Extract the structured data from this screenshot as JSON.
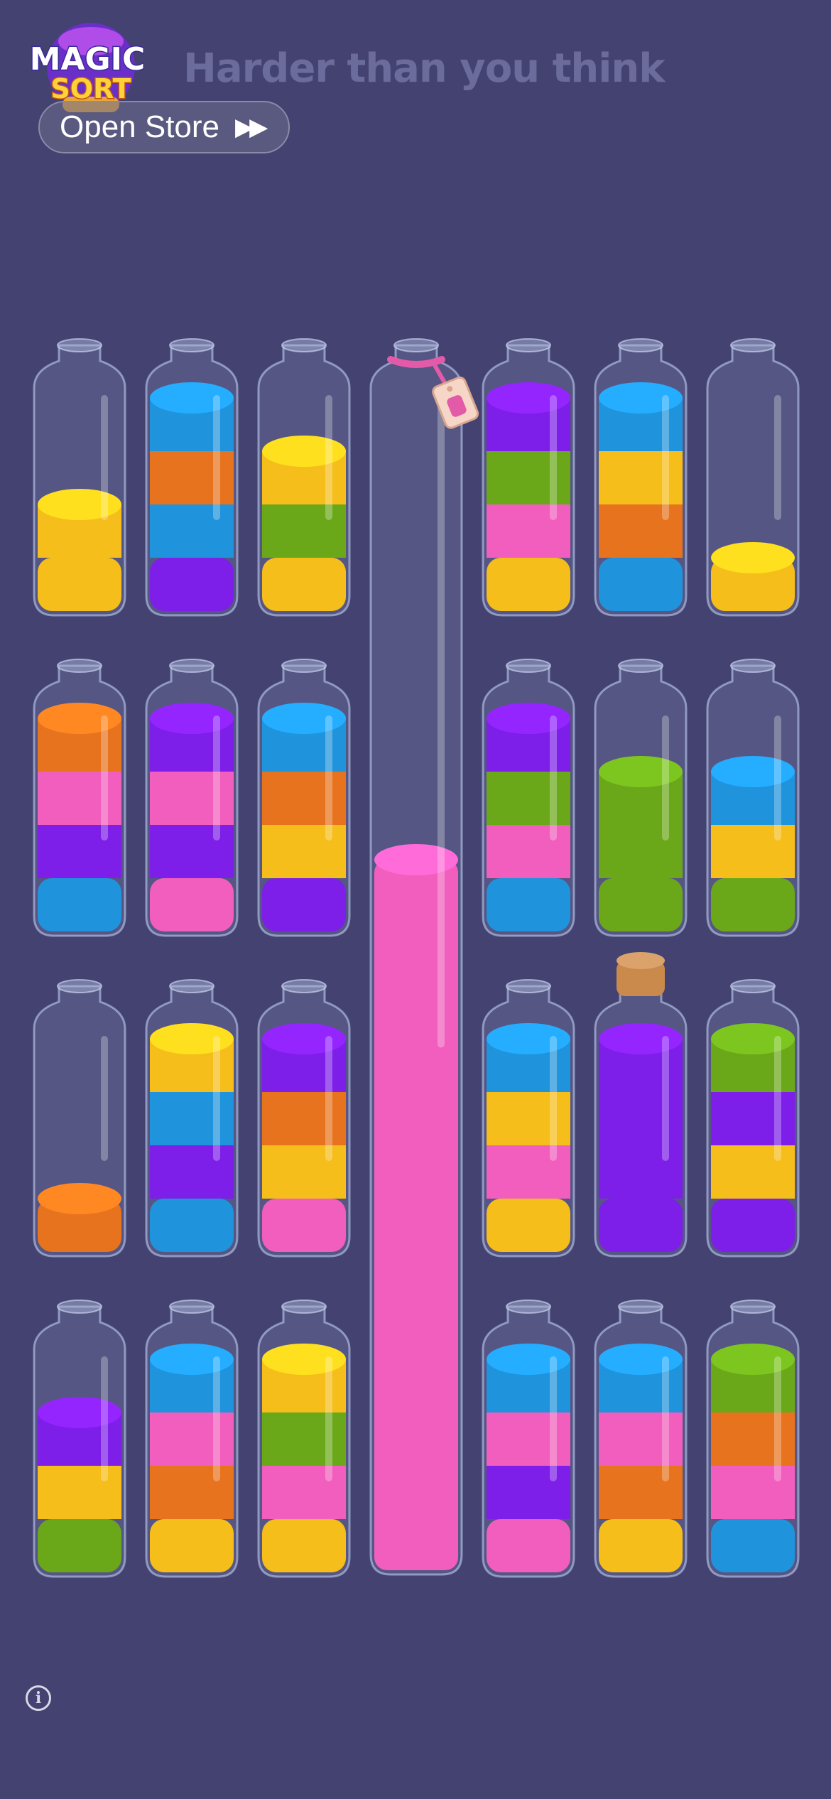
{
  "app": {
    "logo_line1": "MAGIC",
    "logo_line2": "SORT",
    "tagline": "Harder than you think",
    "store_button_label": "Open Store",
    "store_button_icon": "fast-forward-icon",
    "info_icon": "info-icon"
  },
  "colors": {
    "background": "#434270",
    "yellow": "#f5be1a",
    "blue": "#1f93dc",
    "orange": "#e8731e",
    "purple": "#7d1fe8",
    "green": "#6aa81a",
    "pink": "#f25ebd"
  },
  "board": {
    "rows": [
      {
        "bottles": [
          {
            "layers": [
              "yellow",
              "yellow"
            ]
          },
          {
            "layers": [
              "purple",
              "blue",
              "orange",
              "blue"
            ]
          },
          {
            "layers": [
              "yellow",
              "green",
              "yellow"
            ]
          },
          {
            "tall": true,
            "locked_tag": "gift-tag-icon",
            "fill_fraction": 0.59,
            "layers": [
              "pink"
            ]
          },
          {
            "layers": [
              "yellow",
              "pink",
              "green",
              "purple"
            ]
          },
          {
            "layers": [
              "blue",
              "orange",
              "yellow",
              "blue"
            ]
          },
          {
            "layers": [
              "yellow"
            ]
          }
        ]
      },
      {
        "bottles": [
          {
            "layers": [
              "blue",
              "purple",
              "pink",
              "orange"
            ]
          },
          {
            "layers": [
              "pink",
              "purple",
              "pink",
              "purple"
            ]
          },
          {
            "layers": [
              "purple",
              "yellow",
              "orange",
              "blue"
            ]
          },
          {
            "skip": true
          },
          {
            "layers": [
              "blue",
              "pink",
              "green",
              "purple"
            ]
          },
          {
            "layers": [
              "green",
              "green",
              "green"
            ]
          },
          {
            "layers": [
              "green",
              "yellow",
              "blue"
            ]
          }
        ]
      },
      {
        "bottles": [
          {
            "layers": [
              "orange"
            ]
          },
          {
            "layers": [
              "blue",
              "purple",
              "blue",
              "yellow"
            ]
          },
          {
            "layers": [
              "pink",
              "yellow",
              "orange",
              "purple"
            ]
          },
          {
            "skip": true
          },
          {
            "layers": [
              "yellow",
              "pink",
              "yellow",
              "blue"
            ]
          },
          {
            "corked": true,
            "layers": [
              "purple",
              "purple",
              "purple",
              "purple"
            ]
          },
          {
            "layers": [
              "purple",
              "yellow",
              "purple",
              "green"
            ]
          }
        ]
      },
      {
        "bottles": [
          {
            "layers": [
              "green",
              "yellow",
              "purple"
            ]
          },
          {
            "layers": [
              "yellow",
              "orange",
              "pink",
              "blue"
            ]
          },
          {
            "layers": [
              "yellow",
              "pink",
              "green",
              "yellow"
            ]
          },
          {
            "skip": true
          },
          {
            "layers": [
              "pink",
              "purple",
              "pink",
              "blue"
            ]
          },
          {
            "layers": [
              "yellow",
              "orange",
              "pink",
              "blue"
            ]
          },
          {
            "layers": [
              "blue",
              "pink",
              "orange",
              "green"
            ]
          }
        ]
      }
    ]
  }
}
